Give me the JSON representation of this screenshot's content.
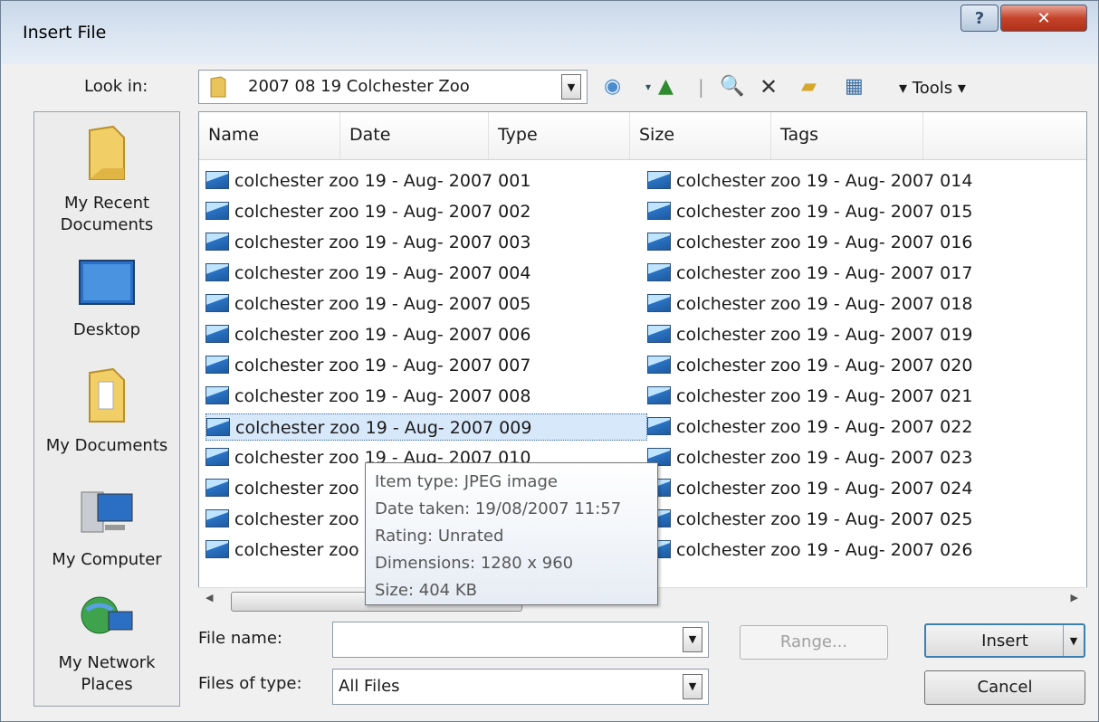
{
  "window": {
    "title": "Insert File"
  },
  "toolbar": {
    "look_in_label": "Look in:",
    "look_in_value": "2007 08 19 Colchester Zoo",
    "tools_label": "Tools"
  },
  "places": [
    {
      "label": "My Recent Documents",
      "icon": "recent-folder-icon"
    },
    {
      "label": "Desktop",
      "icon": "desktop-icon"
    },
    {
      "label": "My Documents",
      "icon": "documents-folder-icon"
    },
    {
      "label": "My Computer",
      "icon": "computer-icon"
    },
    {
      "label": "My Network Places",
      "icon": "network-icon"
    }
  ],
  "columns": [
    "Name",
    "Date",
    "Type",
    "Size",
    "Tags"
  ],
  "files_left": [
    "colchester zoo 19 - Aug- 2007 001",
    "colchester zoo 19 - Aug- 2007 002",
    "colchester zoo 19 - Aug- 2007 003",
    "colchester zoo 19 - Aug- 2007 004",
    "colchester zoo 19 - Aug- 2007 005",
    "colchester zoo 19 - Aug- 2007 006",
    "colchester zoo 19 - Aug- 2007 007",
    "colchester zoo 19 - Aug- 2007 008",
    "colchester zoo 19 - Aug- 2007 009",
    "colchester zoo 19 - Aug- 2007 010",
    "colchester zoo 19 - Aug- 2007 011",
    "colchester zoo 19 - Aug- 2007 012",
    "colchester zoo 19 - Aug- 2007 013"
  ],
  "files_right": [
    "colchester zoo 19 - Aug- 2007 014",
    "colchester zoo 19 - Aug- 2007 015",
    "colchester zoo 19 - Aug- 2007 016",
    "colchester zoo 19 - Aug- 2007 017",
    "colchester zoo 19 - Aug- 2007 018",
    "colchester zoo 19 - Aug- 2007 019",
    "colchester zoo 19 - Aug- 2007 020",
    "colchester zoo 19 - Aug- 2007 021",
    "colchester zoo 19 - Aug- 2007 022",
    "colchester zoo 19 - Aug- 2007 023",
    "colchester zoo 19 - Aug- 2007 024",
    "colchester zoo 19 - Aug- 2007 025",
    "colchester zoo 19 - Aug- 2007 026"
  ],
  "selected_file": "colchester zoo 19 - Aug- 2007 009",
  "tooltip": {
    "item_type": "Item type: JPEG image",
    "date_taken": "Date taken: 19/08/2007 11:57",
    "rating": "Rating: Unrated",
    "dimensions": "Dimensions: 1280 x 960",
    "size": "Size: 404 KB"
  },
  "footer": {
    "file_name_label": "File name:",
    "file_name_value": "",
    "files_of_type_label": "Files of type:",
    "files_of_type_value": "All Files",
    "range_label": "Range...",
    "insert_label": "Insert",
    "cancel_label": "Cancel"
  },
  "colors": {
    "selection": "#d8e8fb",
    "close_button": "#c5432a"
  }
}
